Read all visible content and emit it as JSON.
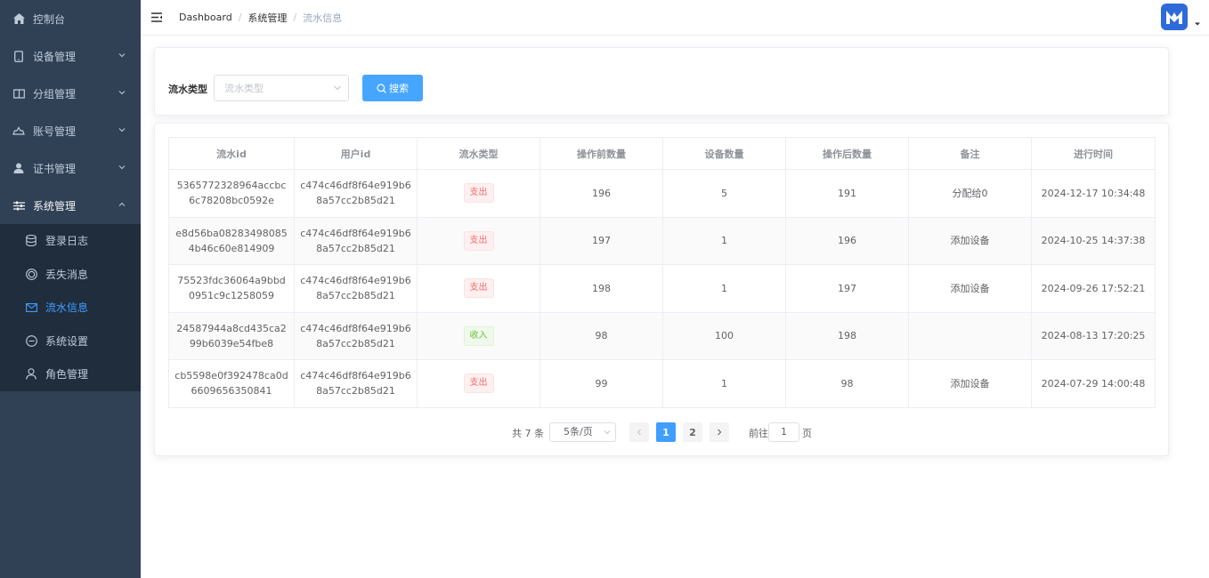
{
  "sidebar": {
    "items": [
      {
        "label": "控制台",
        "icon": "home-icon"
      },
      {
        "label": "设备管理",
        "icon": "tablet-icon"
      },
      {
        "label": "分组管理",
        "icon": "book-icon"
      },
      {
        "label": "账号管理",
        "icon": "cloud-icon"
      },
      {
        "label": "证书管理",
        "icon": "user-icon"
      },
      {
        "label": "系统管理",
        "icon": "sliders-icon"
      }
    ],
    "subitems": [
      {
        "label": "登录日志",
        "icon": "database-icon"
      },
      {
        "label": "丢失消息",
        "icon": "lifebuoy-icon"
      },
      {
        "label": "流水信息",
        "icon": "mail-icon"
      },
      {
        "label": "系统设置",
        "icon": "minus-circle-icon"
      },
      {
        "label": "角色管理",
        "icon": "person-icon"
      }
    ]
  },
  "header": {
    "breadcrumb": [
      "Dashboard",
      "系统管理",
      "流水信息"
    ]
  },
  "search": {
    "label": "流水类型",
    "placeholder": "流水类型",
    "button": "搜索"
  },
  "table": {
    "columns": [
      "流水id",
      "用户id",
      "流水类型",
      "操作前数量",
      "设备数量",
      "操作后数量",
      "备注",
      "进行时间"
    ],
    "rows": [
      {
        "id": "5365772328964accbc6c78208bc0592e",
        "user": "c474c46df8f64e919b68a57cc2b85d21",
        "type": "支出",
        "type_kind": "out",
        "before": "196",
        "count": "5",
        "after": "191",
        "note": "分配给0",
        "time": "2024-12-17 10:34:48"
      },
      {
        "id": "e8d56ba082834980854b46c60e814909",
        "user": "c474c46df8f64e919b68a57cc2b85d21",
        "type": "支出",
        "type_kind": "out",
        "before": "197",
        "count": "1",
        "after": "196",
        "note": "添加设备",
        "time": "2024-10-25 14:37:38"
      },
      {
        "id": "75523fdc36064a9bbd0951c9c1258059",
        "user": "c474c46df8f64e919b68a57cc2b85d21",
        "type": "支出",
        "type_kind": "out",
        "before": "198",
        "count": "1",
        "after": "197",
        "note": "添加设备",
        "time": "2024-09-26 17:52:21"
      },
      {
        "id": "24587944a8cd435ca299b6039e54fbe8",
        "user": "c474c46df8f64e919b68a57cc2b85d21",
        "type": "收入",
        "type_kind": "in",
        "before": "98",
        "count": "100",
        "after": "198",
        "note": "",
        "time": "2024-08-13 17:20:25"
      },
      {
        "id": "cb5598e0f392478ca0d6609656350841",
        "user": "c474c46df8f64e919b68a57cc2b85d21",
        "type": "支出",
        "type_kind": "out",
        "before": "99",
        "count": "1",
        "after": "98",
        "note": "添加设备",
        "time": "2024-07-29 14:00:48"
      }
    ]
  },
  "pagination": {
    "total": "共 7 条",
    "page_size": "5条/页",
    "pages": [
      "1",
      "2"
    ],
    "current": "1",
    "goto_prefix": "前往",
    "goto_value": "1",
    "goto_suffix": "页"
  },
  "colors": {
    "sidebar_bg": "#304156",
    "submenu_bg": "#1f2d3d",
    "accent": "#409eff",
    "tag_out": "#f56c6c",
    "tag_in": "#67c23a",
    "avatar": "#2d6bd8"
  }
}
